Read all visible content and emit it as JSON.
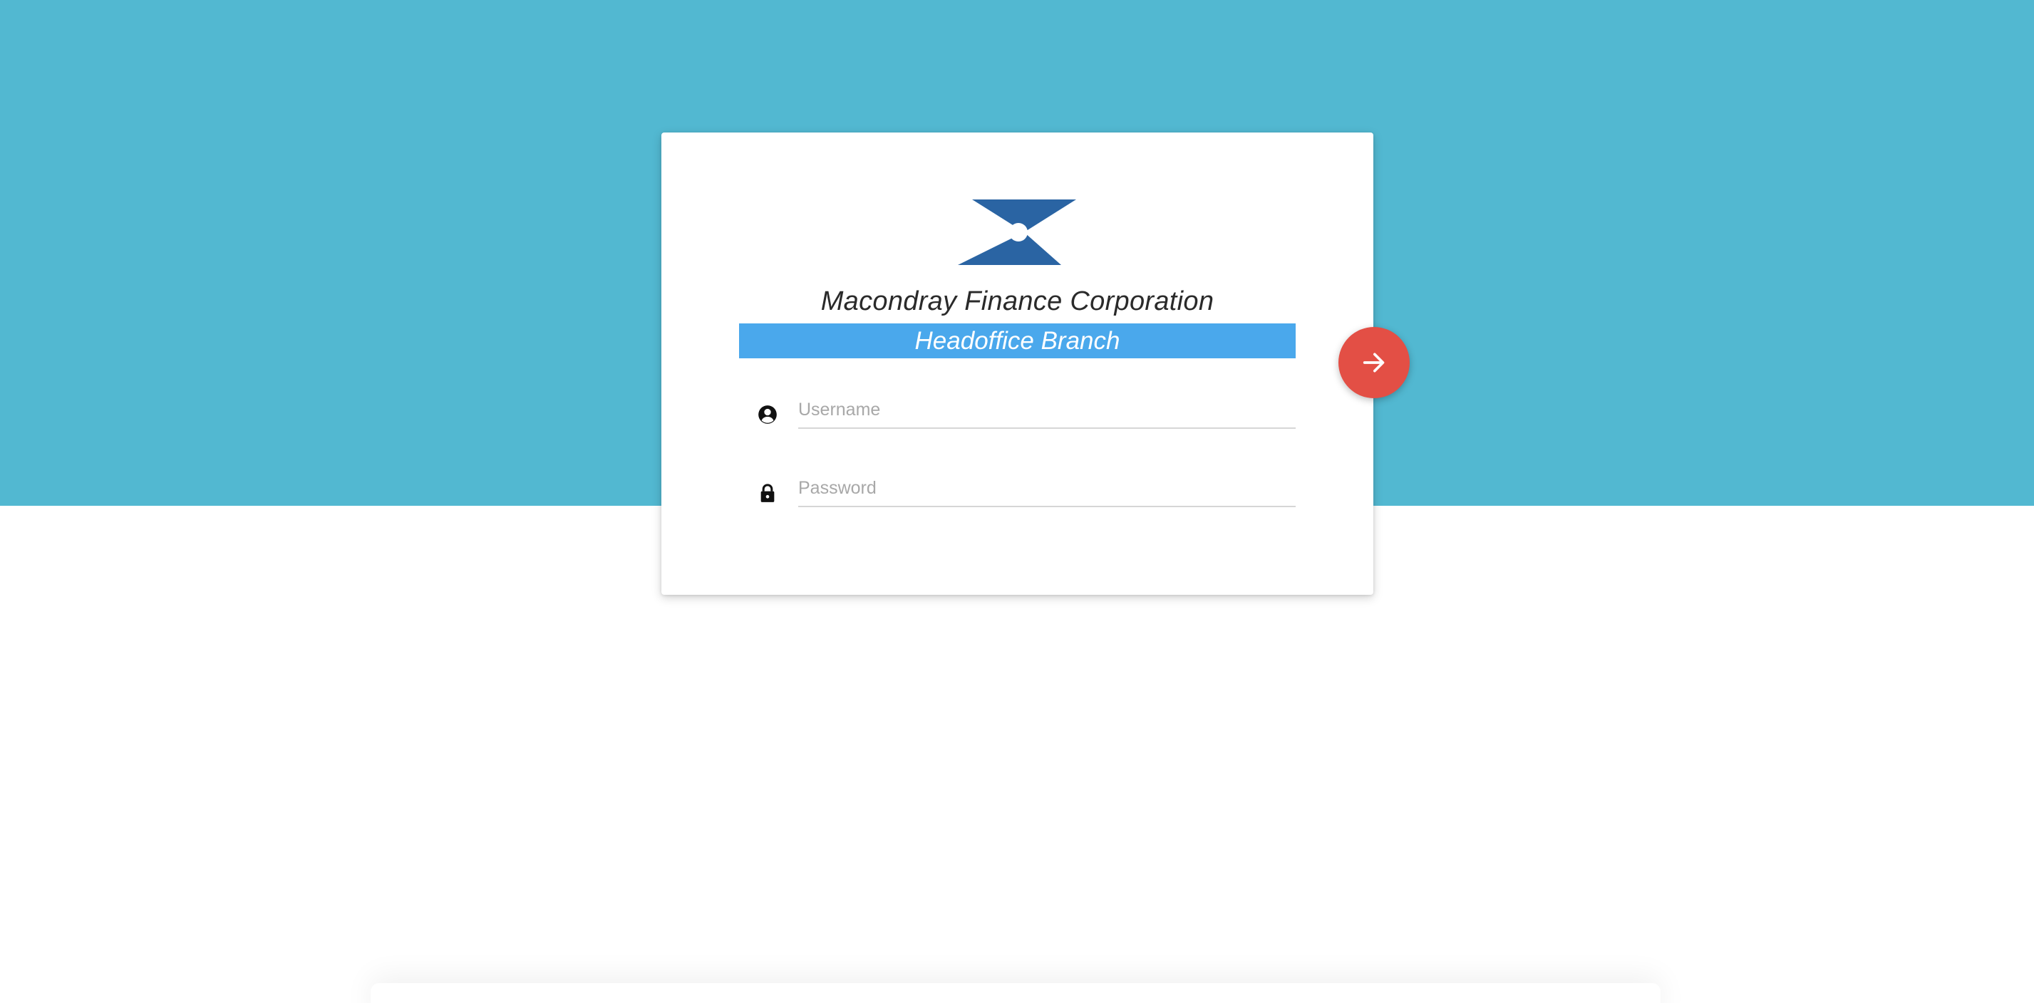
{
  "brand": {
    "company_name": "Macondray Finance Corporation",
    "branch_name": "Headoffice Branch",
    "logo_icon": "hourglass-x-logo-icon",
    "colors": {
      "hero_background": "#52b8d1",
      "branch_bar": "#4aa8ec",
      "logo": "#2a64a3",
      "submit_button": "#e34f45"
    }
  },
  "login_form": {
    "username": {
      "icon": "account-circle-icon",
      "placeholder": "Username",
      "value": ""
    },
    "password": {
      "icon": "lock-icon",
      "placeholder": "Password",
      "value": ""
    },
    "submit": {
      "icon": "arrow-right-icon"
    }
  }
}
